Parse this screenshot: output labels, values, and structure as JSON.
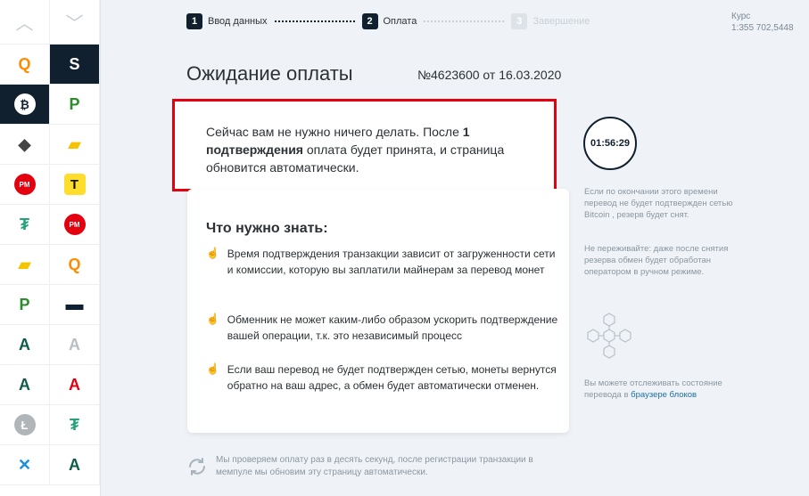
{
  "sidebar": {
    "up_arrow": "︿",
    "down_arrow": "﹀",
    "items": [
      {
        "left": {
          "name": "qiwi",
          "glyph": "Q",
          "color": "#ff8c00"
        },
        "right": {
          "name": "sberbank",
          "glyph": "S",
          "color": "#ffffff",
          "active": true
        }
      },
      {
        "left": {
          "name": "bitcoin",
          "glyph": "₿",
          "color": "#ffffff",
          "active": true
        },
        "right": {
          "name": "privatbank",
          "glyph": "P",
          "color": "#2c8c2c"
        }
      },
      {
        "left": {
          "name": "ethereum",
          "glyph": "◆",
          "color": "#444444"
        },
        "right": {
          "name": "yandex-money",
          "glyph": "▰",
          "color": "#f5c400"
        }
      },
      {
        "left": {
          "name": "perfect-money",
          "glyph": "PM",
          "color": "#e3000f"
        },
        "right": {
          "name": "tinkoff",
          "glyph": "T",
          "color": "#111111"
        }
      },
      {
        "left": {
          "name": "tether",
          "glyph": "₮",
          "color": "#26a17b"
        },
        "right": {
          "name": "perfect-money",
          "glyph": "PM",
          "color": "#e3000f"
        }
      },
      {
        "left": {
          "name": "yandex-money",
          "glyph": "▰",
          "color": "#f5c400"
        },
        "right": {
          "name": "qiwi",
          "glyph": "Q",
          "color": "#ff8c00"
        }
      },
      {
        "left": {
          "name": "privatbank",
          "glyph": "P",
          "color": "#2c8c2c"
        },
        "right": {
          "name": "bank-card",
          "glyph": "▬",
          "color": "#0f2033"
        }
      },
      {
        "left": {
          "name": "advcash",
          "glyph": "A",
          "color": "#0f5c4a"
        },
        "right": {
          "name": "advcash-gray",
          "glyph": "A",
          "color": "#b8bec4"
        }
      },
      {
        "left": {
          "name": "advcash",
          "glyph": "A",
          "color": "#0f5c4a"
        },
        "right": {
          "name": "alfa-bank",
          "glyph": "A",
          "color": "#e3000f"
        }
      },
      {
        "left": {
          "name": "litecoin",
          "glyph": "Ł",
          "color": "#b0b5ba"
        },
        "right": {
          "name": "tether",
          "glyph": "₮",
          "color": "#26a17b"
        }
      },
      {
        "left": {
          "name": "ripple",
          "glyph": "✕",
          "color": "#1a8fd6"
        },
        "right": {
          "name": "advcash",
          "glyph": "A",
          "color": "#0f5c4a"
        }
      }
    ]
  },
  "stepper": {
    "steps": [
      {
        "num": "1",
        "label": "Ввод данных"
      },
      {
        "num": "2",
        "label": "Оплата"
      },
      {
        "num": "3",
        "label": "Завершение"
      }
    ]
  },
  "rate": {
    "label": "Курс",
    "value": "1:355 702,5448"
  },
  "header": {
    "title": "Ожидание оплаты",
    "order": "№4623600  от  16.03.2020"
  },
  "notice": {
    "part1": "Сейчас вам не нужно ничего делать. После ",
    "bold": "1 подтверждения",
    "part2": " оплата будет принята, и страница обновится автоматически."
  },
  "info": {
    "title": "Что нужно знать:",
    "items": [
      "Время подтверждения транзакции зависит от загруженности сети и комиссии, которую вы заплатили майнерам за перевод монет",
      "Обменник не может каким-либо образом ускорить подтверждение вашей операции, т.к. это независимый процесс",
      "Если ваш перевод не будет подтвержден сетью, монеты вернутся обратно на ваш адрес, а обмен будет автоматически отменен."
    ]
  },
  "timer": {
    "value": "01:56:29"
  },
  "side": {
    "note1": "Если по окончании этого времени перевод не будет подтвержден сетью Bitcoin , резерв будет снят.",
    "note2": "Не переживайте: даже после снятия резерва обмен будет обработан оператором в ручном режиме.",
    "note3_prefix": "Вы можете отслеживать состояние перевода в ",
    "note3_link": "браузере блоков"
  },
  "footer": {
    "text": "Мы проверяем оплату раз в десять секунд, после регистрации транзакции в мемпуле мы обновим эту страницу автоматически."
  },
  "colors": {
    "accent": "#10202f",
    "highlight": "#e3000f",
    "link": "#1a6ea8"
  }
}
